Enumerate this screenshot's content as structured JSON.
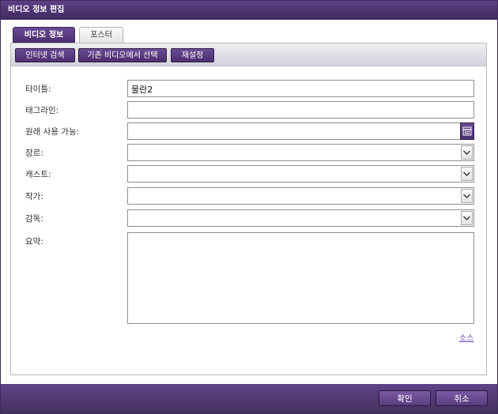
{
  "window": {
    "title": "비디오 정보 편집"
  },
  "tabs": [
    {
      "label": "비디오 정보",
      "active": true
    },
    {
      "label": "포스터",
      "active": false
    }
  ],
  "toolbar": {
    "internet_search": "인터넷 검색",
    "select_existing": "기존 비디오에서 선택",
    "reset": "재설정"
  },
  "form": {
    "title": {
      "label": "타이틀:",
      "value": "물란2"
    },
    "tagline": {
      "label": "태그라인:",
      "value": ""
    },
    "originally_available": {
      "label": "원래 사용 가능:",
      "value": "",
      "icon": "calendar-icon"
    },
    "genre": {
      "label": "장르:",
      "value": ""
    },
    "cast": {
      "label": "캐스트:",
      "value": ""
    },
    "writer": {
      "label": "작가:",
      "value": ""
    },
    "director": {
      "label": "감독:",
      "value": ""
    },
    "summary": {
      "label": "요약:",
      "value": ""
    }
  },
  "source_link": "소스",
  "footer": {
    "ok": "확인",
    "cancel": "취소"
  },
  "colors": {
    "accent": "#4f3374",
    "border": "#8f8f8f"
  }
}
